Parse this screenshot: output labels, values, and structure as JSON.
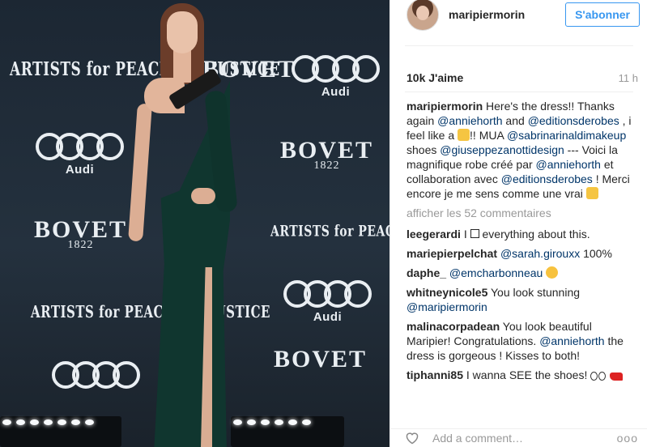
{
  "photo": {
    "backdrop_texts": {
      "apj": "ARTISTS for PEACE and JUSTICE",
      "bovet": "BOVET",
      "bovet_year": "1822",
      "audi": "Audi"
    }
  },
  "header": {
    "username": "maripiermorin",
    "follow_label": "S'abonner"
  },
  "post_meta": {
    "likes": "10k J'aime",
    "time": "11 h"
  },
  "caption": {
    "user": "maripiermorin",
    "t1": " Here's the dress!! Thanks again ",
    "m1": "@anniehorth",
    "t2": " and ",
    "m2": "@editionsderobes",
    "t3": " , i feel like a ",
    "t4": "!! MUA ",
    "m3": "@sabrinarinaldimakeup",
    "t5": " shoes ",
    "m4": "@giuseppezanottidesign",
    "t6": " --- Voici la magnifique robe créé par ",
    "m5": "@anniehorth",
    "t7": " et collaboration avec ",
    "m6": "@editionsderobes",
    "t8": " ! Merci encore je me sens comme une vrai "
  },
  "more_comments": "afficher les 52 commentaires",
  "comments": [
    {
      "user": "leegerardi",
      "pre": " I ",
      "post": " everything about this."
    },
    {
      "user": "mariepierpelchat",
      "mention": "@sarah.girouxx",
      "text": " 100%"
    },
    {
      "user": "daphe_",
      "mention": "@emcharbonneau"
    },
    {
      "user": "whitneynicole5",
      "text": " You look stunning ",
      "mention": "@maripiermorin"
    },
    {
      "user": "malinacorpadean",
      "text": " You look beautiful Maripier! Congratulations. ",
      "mention": "@anniehorth",
      "text2": " the dress is gorgeous ! Kisses to both!"
    },
    {
      "user": "tiphanni85",
      "text": " I wanna SEE the shoes! "
    }
  ],
  "footer": {
    "add_comment_placeholder": "Add a comment…",
    "more_label": "ooo"
  }
}
